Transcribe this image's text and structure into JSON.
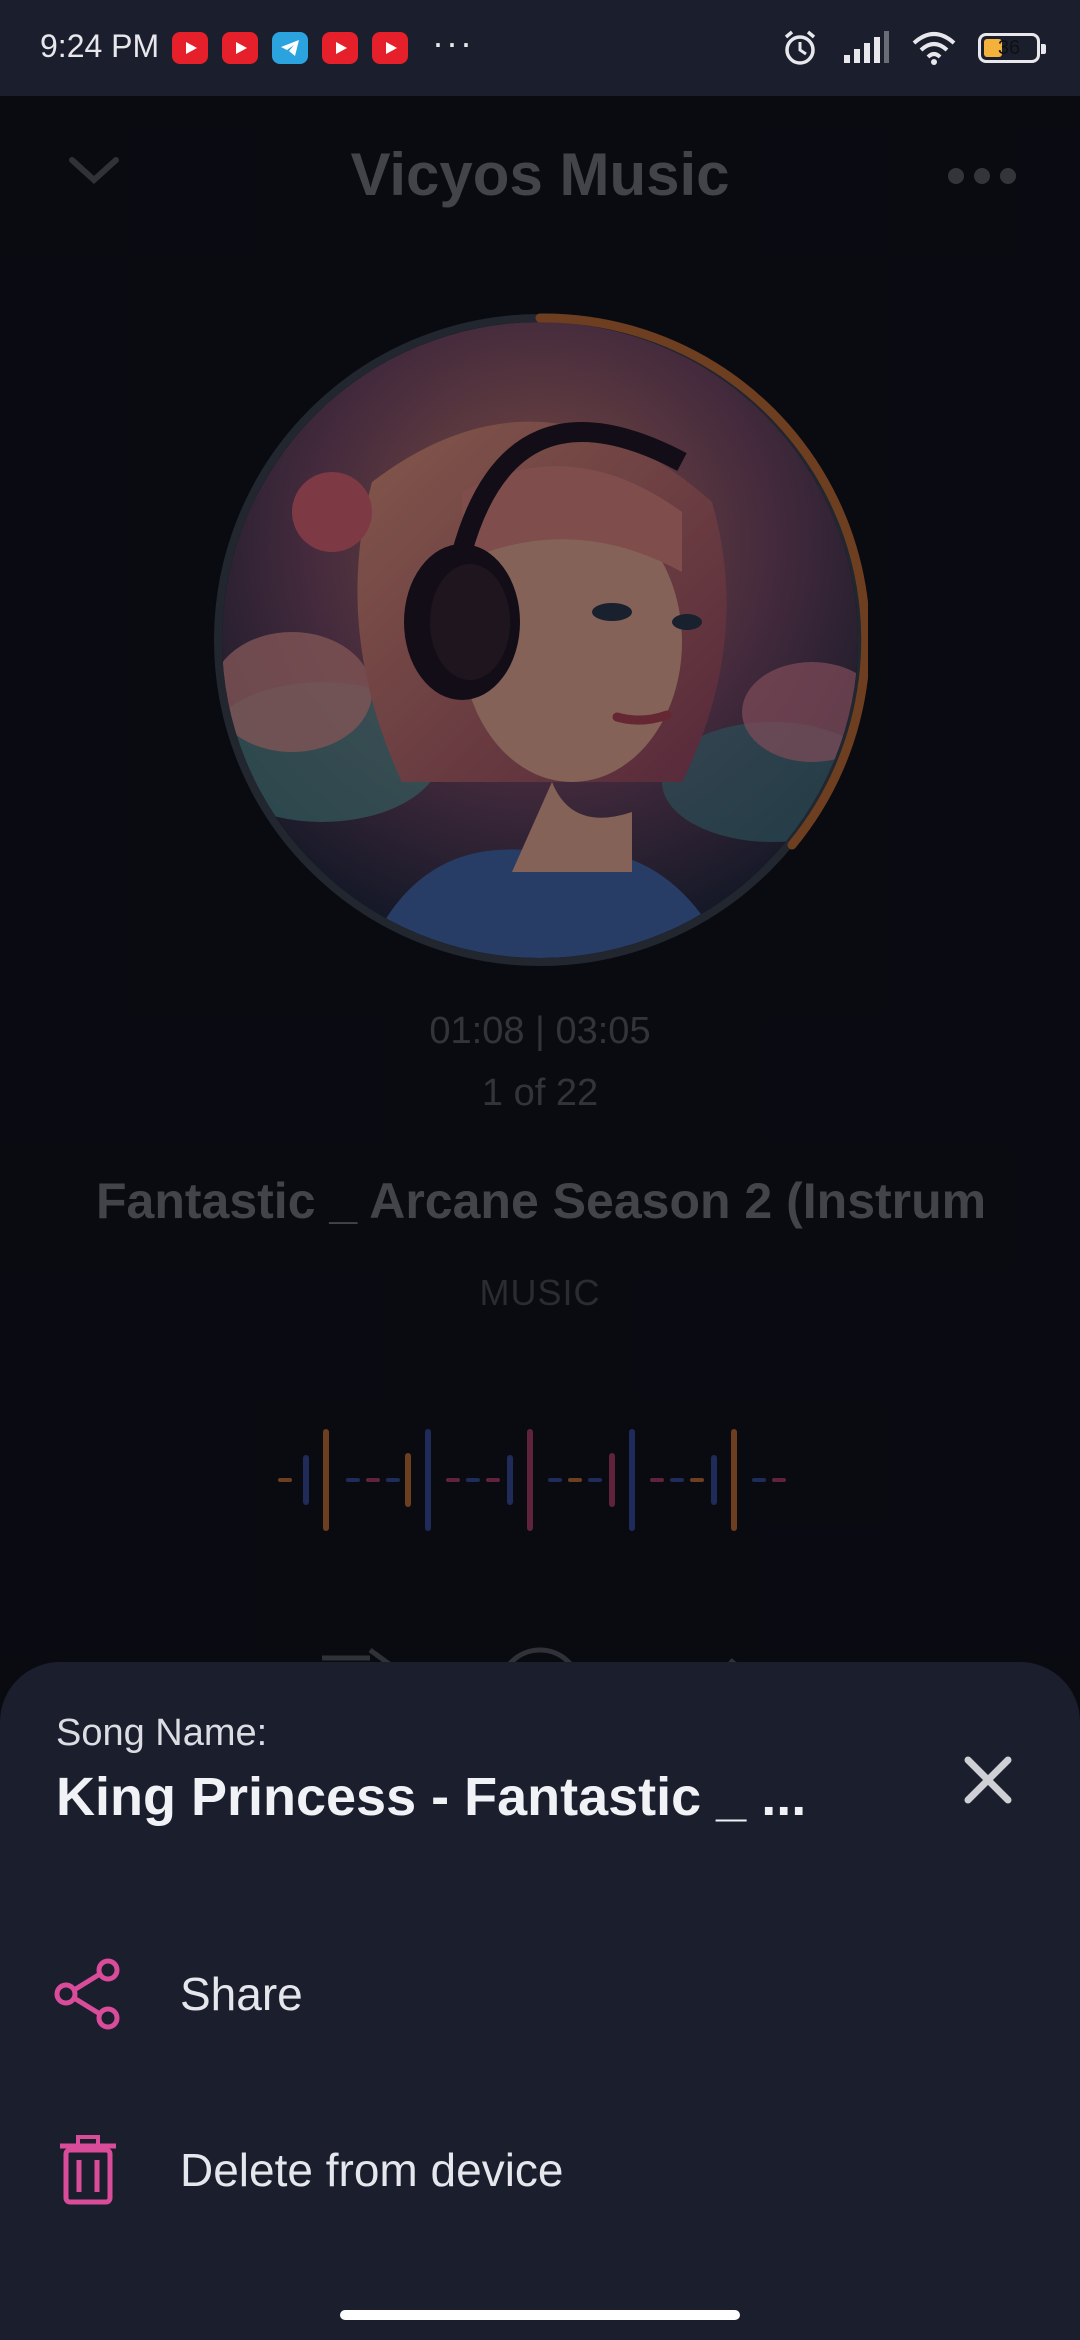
{
  "status_bar": {
    "time": "9:24 PM",
    "notification_icons": [
      "youtube-icon",
      "youtube-icon",
      "telegram-icon",
      "youtube-icon",
      "youtube-icon"
    ],
    "more": "···",
    "battery_level": "36",
    "system_icons": [
      "alarm-icon",
      "signal-icon",
      "wifi-icon",
      "battery-icon"
    ]
  },
  "player": {
    "app_title": "Vicyos Music",
    "time": "01:08 | 03:05",
    "track_position": "1 of 22",
    "song_title": "Fantastic _ Arcane Season 2 (Instrum",
    "artist": "MUSIC",
    "progress_fraction": 0.37,
    "colors": {
      "progress_ring": "#c8713c",
      "wave_orange": "#c8713c",
      "wave_blue": "#3a4fa0",
      "wave_pink": "#b0406e"
    }
  },
  "sheet": {
    "song_name_label": "Song Name:",
    "song_name": "King Princess - Fantastic _ ...",
    "options": [
      {
        "label": "Share",
        "icon": "share-icon"
      },
      {
        "label": "Delete from device",
        "icon": "trash-icon"
      }
    ],
    "accent_color": "#d94c9a",
    "close_icon": "close-icon"
  }
}
